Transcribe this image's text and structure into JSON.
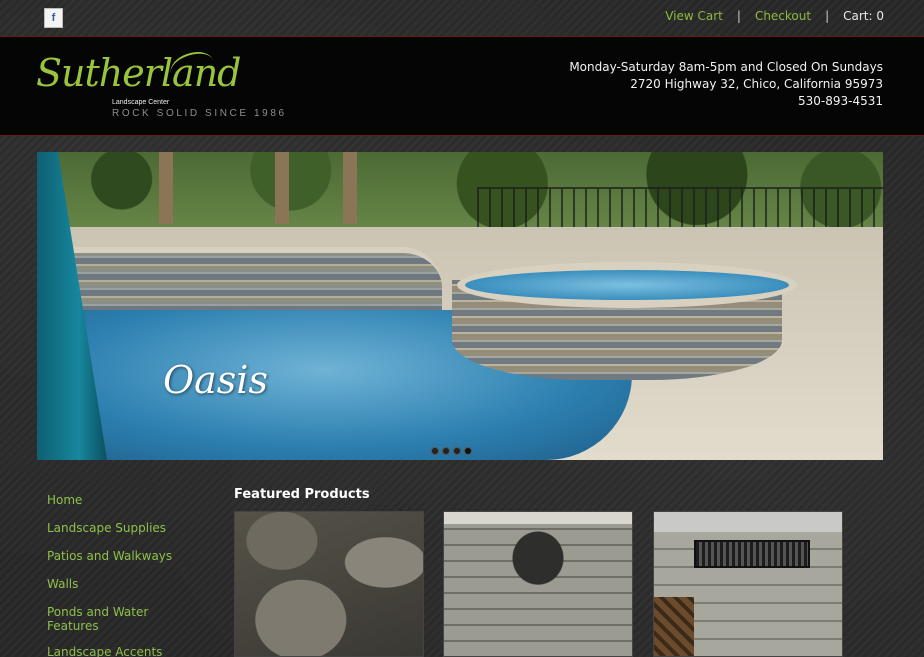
{
  "topbar": {
    "facebook_icon": "f",
    "view_cart": "View Cart",
    "separator": "|",
    "checkout": "Checkout",
    "cart": "Cart: 0"
  },
  "header": {
    "logo_script": "Sutherland",
    "logo_sub": "Landscape Center",
    "logo_tagline": "ROCK SOLID SINCE 1986",
    "hours": "Monday-Saturday 8am-5pm and Closed On Sundays",
    "address": "2720 Highway 32, Chico, California 95973",
    "phone": "530-893-4531"
  },
  "hero": {
    "caption": "Oasis",
    "slide_count": 4,
    "active_slide": 4
  },
  "sidebar": {
    "items": [
      {
        "label": "Home"
      },
      {
        "label": "Landscape Supplies"
      },
      {
        "label": "Patios and Walkways"
      },
      {
        "label": "Walls"
      },
      {
        "label": "Ponds and Water Features"
      },
      {
        "label": "Landscape Accents"
      }
    ]
  },
  "featured": {
    "title": "Featured Products"
  },
  "colors": {
    "accent_green": "#8fc04a",
    "header_bg": "#050505",
    "header_border": "#6b1a1a"
  }
}
